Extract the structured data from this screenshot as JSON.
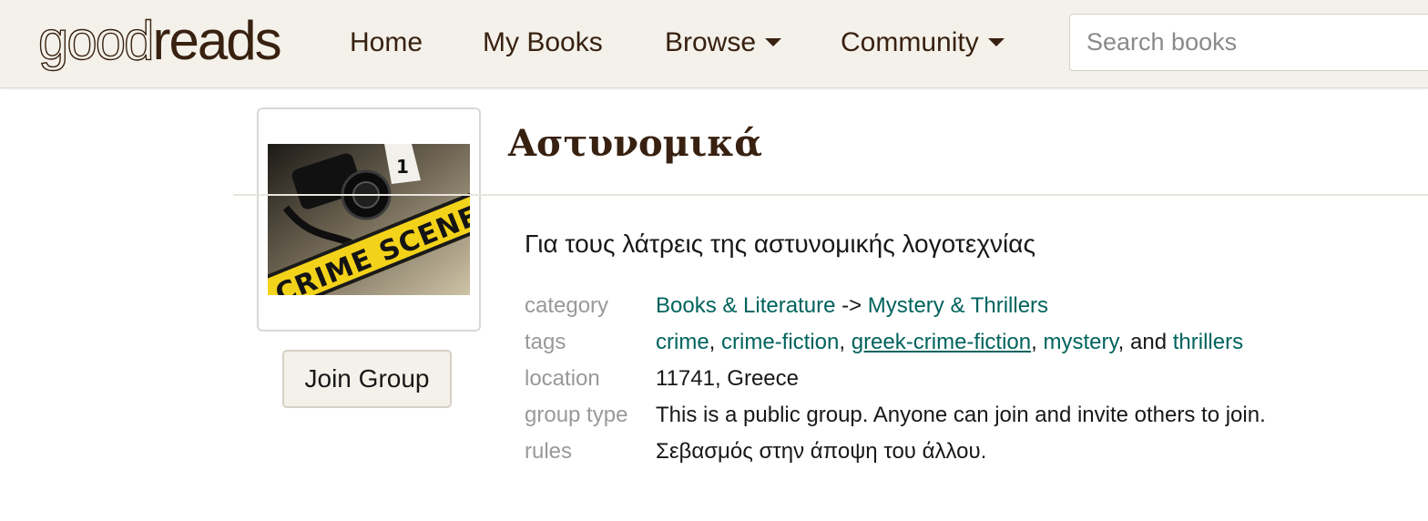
{
  "header": {
    "logo": {
      "part1": "good",
      "part2": "reads"
    },
    "nav": [
      {
        "label": "Home",
        "has_caret": false
      },
      {
        "label": "My Books",
        "has_caret": false
      },
      {
        "label": "Browse",
        "has_caret": true
      },
      {
        "label": "Community",
        "has_caret": true
      }
    ],
    "search": {
      "placeholder": "Search books",
      "value": ""
    }
  },
  "group": {
    "title": "Αστυνομικά",
    "description": "Για τους λάτρεις της αστυνομικής λογοτεχνίας",
    "image_text": "CRIME SCENE",
    "image_marker": "1",
    "join_label": "Join Group",
    "details": {
      "category": {
        "key": "category",
        "parent": "Books & Literature",
        "arrow": "->",
        "child": "Mystery & Thrillers"
      },
      "tags": {
        "key": "tags",
        "items": [
          "crime",
          "crime-fiction",
          "greek-crime-fiction",
          "mystery",
          "thrillers"
        ],
        "conjunction": "and"
      },
      "location": {
        "key": "location",
        "value": "11741, Greece"
      },
      "group_type": {
        "key": "group type",
        "value": "This is a public group. Anyone can join and invite others to join."
      },
      "rules": {
        "key": "rules",
        "value": "Σεβασμός στην άποψη του άλλου."
      }
    }
  },
  "colors": {
    "header_bg": "#f4f1ea",
    "brand_brown": "#382110",
    "link_green": "#00635d",
    "muted_label": "#999999"
  }
}
